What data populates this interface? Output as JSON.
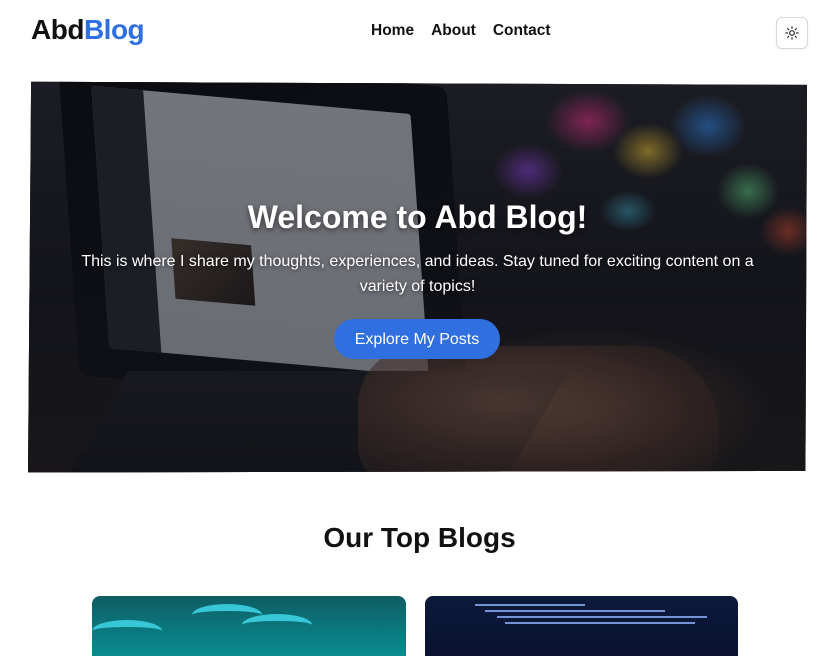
{
  "header": {
    "logo_part1": "Abd",
    "logo_part2": "Blog",
    "nav": [
      {
        "label": "Home"
      },
      {
        "label": "About"
      },
      {
        "label": "Contact"
      }
    ],
    "theme_toggle_icon": "sun-icon"
  },
  "hero": {
    "title": "Welcome to Abd Blog!",
    "description": "This is where I share my thoughts, experiences, and ideas. Stay tuned for exciting content on a variety of topics!",
    "cta_label": "Explore My Posts",
    "background_image": "laptop-typing-photo"
  },
  "section": {
    "title": "Our Top Blogs"
  },
  "cards": [
    {
      "image": "tailwind-waves-thumbnail"
    },
    {
      "image": "code-screen-thumbnail"
    }
  ],
  "colors": {
    "accent": "#2f6fe0",
    "text": "#111111",
    "background": "#ffffff"
  }
}
